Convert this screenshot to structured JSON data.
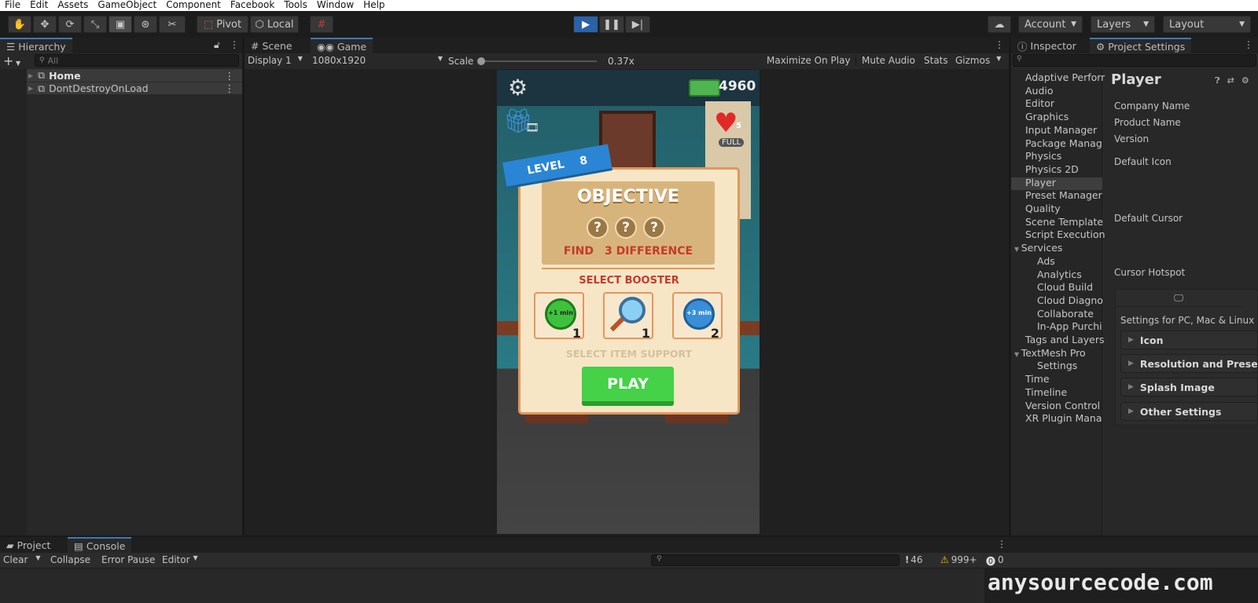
{
  "menu": [
    "File",
    "Edit",
    "Assets",
    "GameObject",
    "Component",
    "Facebook",
    "Tools",
    "Window",
    "Help"
  ],
  "toolbar": {
    "pivot_label": "Pivot",
    "local_label": "Local",
    "account_label": "Account",
    "layers_label": "Layers",
    "layout_label": "Layout"
  },
  "hierarchy": {
    "tab_label": "Hierarchy",
    "search_placeholder": "All",
    "items": [
      {
        "label": "Home"
      },
      {
        "label": "DontDestroyOnLoad"
      }
    ]
  },
  "game_panel": {
    "tabs": [
      {
        "label": "Scene"
      },
      {
        "label": "Game"
      }
    ],
    "display_label": "Display 1",
    "resolution_label": "1080x1920",
    "scale_label": "Scale",
    "scale_value": "0.37x",
    "scale_slider_fraction": 0.02,
    "buttons": [
      "Maximize On Play",
      "Mute Audio",
      "Stats",
      "Gizmos"
    ]
  },
  "game": {
    "coins": "4960",
    "lives_count": "5",
    "lives_status": "FULL",
    "level_label": "LEVEL",
    "level_number": "8",
    "objective_title": "OBJECTIVE",
    "objective_find": "FIND",
    "objective_count": "3 DIFFERENCE",
    "select_booster": "SELECT BOOSTER",
    "boosters": [
      {
        "icon": "green-stopwatch-icon",
        "caption": "+1 min",
        "count": "1"
      },
      {
        "icon": "magnifier-icon",
        "caption": "",
        "count": "1"
      },
      {
        "icon": "blue-stopwatch-icon",
        "caption": "+3 min",
        "count": "2"
      }
    ],
    "select_item_support": "SELECT ITEM SUPPORT",
    "play_label": "PLAY"
  },
  "inspector": {
    "tabs": [
      {
        "label": "Inspector"
      },
      {
        "label": "Project Settings"
      }
    ],
    "sidebar": [
      {
        "label": "Adaptive Perforr",
        "indent": 0
      },
      {
        "label": "Audio",
        "indent": 0
      },
      {
        "label": "Editor",
        "indent": 0
      },
      {
        "label": "Graphics",
        "indent": 0
      },
      {
        "label": "Input Manager",
        "indent": 0
      },
      {
        "label": "Package Manag",
        "indent": 0
      },
      {
        "label": "Physics",
        "indent": 0
      },
      {
        "label": "Physics 2D",
        "indent": 0
      },
      {
        "label": "Player",
        "indent": 0
      },
      {
        "label": "Preset Manager",
        "indent": 0
      },
      {
        "label": "Quality",
        "indent": 0
      },
      {
        "label": "Scene Template",
        "indent": 0
      },
      {
        "label": "Script Execution",
        "indent": 0
      },
      {
        "label": "Services",
        "indent": 0
      },
      {
        "label": "Ads",
        "indent": 1
      },
      {
        "label": "Analytics",
        "indent": 1
      },
      {
        "label": "Cloud Build",
        "indent": 1
      },
      {
        "label": "Cloud Diagno",
        "indent": 1
      },
      {
        "label": "Collaborate",
        "indent": 1
      },
      {
        "label": "In-App Purchi",
        "indent": 1
      },
      {
        "label": "Tags and Layers",
        "indent": 0
      },
      {
        "label": "TextMesh Pro",
        "indent": 0
      },
      {
        "label": "Settings",
        "indent": 1
      },
      {
        "label": "Time",
        "indent": 0
      },
      {
        "label": "Timeline",
        "indent": 0
      },
      {
        "label": "Version Control",
        "indent": 0
      },
      {
        "label": "XR Plugin Mana",
        "indent": 0
      }
    ],
    "title": "Player",
    "fields": [
      "Company Name",
      "Product Name",
      "Version",
      "Default Icon",
      "Default Cursor",
      "Cursor Hotspot"
    ],
    "platform_label": "Settings for PC, Mac & Linux",
    "foldouts": [
      "Icon",
      "Resolution and Presentation",
      "Splash Image",
      "Other Settings"
    ]
  },
  "bottom": {
    "tabs": [
      {
        "label": "Project"
      },
      {
        "label": "Console"
      }
    ],
    "toolbar": [
      "Clear",
      "Collapse",
      "Error Pause",
      "Editor"
    ],
    "counts": {
      "info": "46",
      "warning": "999+",
      "error": "0"
    }
  },
  "watermark": "anysourcecode.com"
}
